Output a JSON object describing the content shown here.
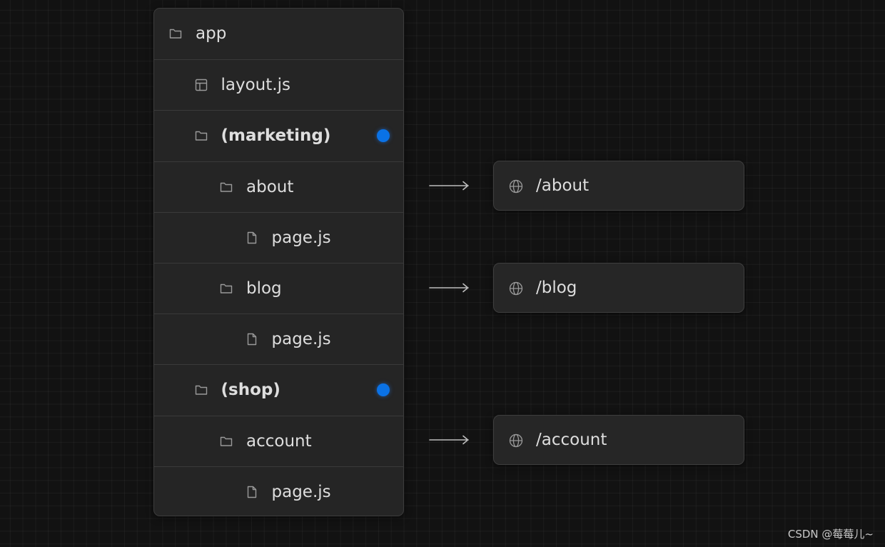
{
  "tree": {
    "rows": [
      {
        "label": "app",
        "icon": "folder-icon",
        "depth": 0,
        "group": false,
        "dot": false
      },
      {
        "label": "layout.js",
        "icon": "layout-icon",
        "depth": 1,
        "group": false,
        "dot": false
      },
      {
        "label": "(marketing)",
        "icon": "folder-icon",
        "depth": 1,
        "group": true,
        "dot": true
      },
      {
        "label": "about",
        "icon": "folder-icon",
        "depth": 2,
        "group": false,
        "dot": false
      },
      {
        "label": "page.js",
        "icon": "file-icon",
        "depth": 3,
        "group": false,
        "dot": false
      },
      {
        "label": "blog",
        "icon": "folder-icon",
        "depth": 2,
        "group": false,
        "dot": false
      },
      {
        "label": "page.js",
        "icon": "file-icon",
        "depth": 3,
        "group": false,
        "dot": false
      },
      {
        "label": "(shop)",
        "icon": "folder-icon",
        "depth": 1,
        "group": true,
        "dot": true
      },
      {
        "label": "account",
        "icon": "folder-icon",
        "depth": 2,
        "group": false,
        "dot": false
      },
      {
        "label": "page.js",
        "icon": "file-icon",
        "depth": 3,
        "group": false,
        "dot": false
      }
    ]
  },
  "routes": [
    {
      "label": "/about",
      "icon": "globe-icon",
      "from_row": 3
    },
    {
      "label": "/blog",
      "icon": "globe-icon",
      "from_row": 5
    },
    {
      "label": "/account",
      "icon": "globe-icon",
      "from_row": 8
    }
  ],
  "colors": {
    "background": "#121212",
    "panel": "#252525",
    "text": "#dedede",
    "icon": "#9a9a9a",
    "accent_dot": "#0a72e6"
  },
  "watermark": "CSDN @莓莓儿~"
}
